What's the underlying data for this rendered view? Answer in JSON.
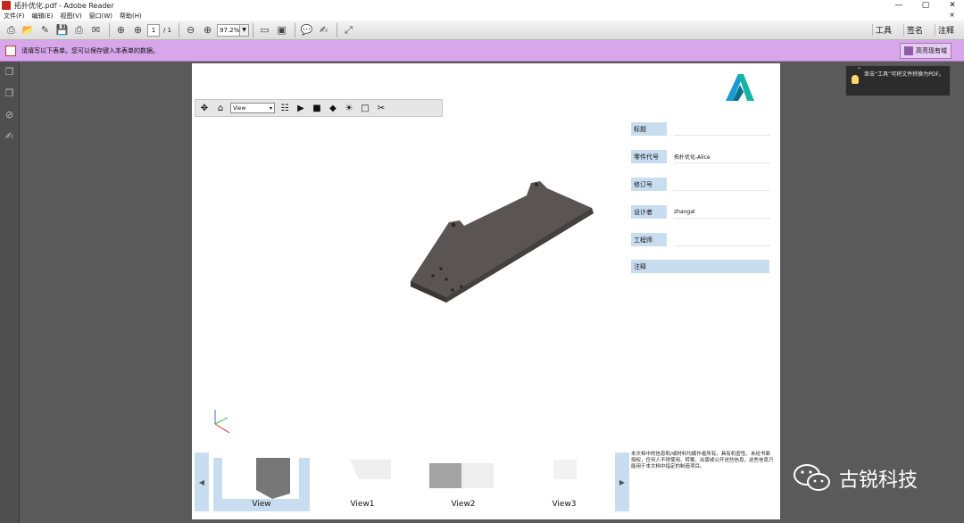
{
  "window": {
    "title": "拓扑优化.pdf - Adobe Reader",
    "controls": [
      "—",
      "▢",
      "✕"
    ]
  },
  "menu": {
    "items": [
      "文件(F)",
      "编辑(E)",
      "视图(V)",
      "窗口(W)",
      "帮助(H)"
    ],
    "close": "×"
  },
  "toolbar": {
    "page_current": "1",
    "page_total": "/ 1",
    "zoom": "97.2%",
    "right": [
      "工具",
      "签名",
      "注释"
    ]
  },
  "formbar": {
    "message": "请填写以下表单。您可以保存键入本表单的数据。",
    "highlight_button": "高亮现有域"
  },
  "viewer3d": {
    "view_select": "View"
  },
  "fields": [
    {
      "label": "标题",
      "value": ""
    },
    {
      "label": "零件代号",
      "value": "拓扑优化-Alice"
    },
    {
      "label": "修订号",
      "value": ""
    },
    {
      "label": "设计者",
      "value": "zhangal"
    },
    {
      "label": "工程师",
      "value": ""
    }
  ],
  "notes_label": "注释",
  "disclaimer": "本文档中的信息和/或材料均属作者所有，具有机密性。未经书面授权，任何人不得使用、转载、出版或公开这些信息。这些信息只能用于本文档中指定的制造项目。",
  "thumbnails": [
    "View",
    "View1",
    "View2",
    "View3"
  ],
  "tooltip": "单击“工具”可将文件转换为PDF。",
  "watermark": "古锐科技"
}
